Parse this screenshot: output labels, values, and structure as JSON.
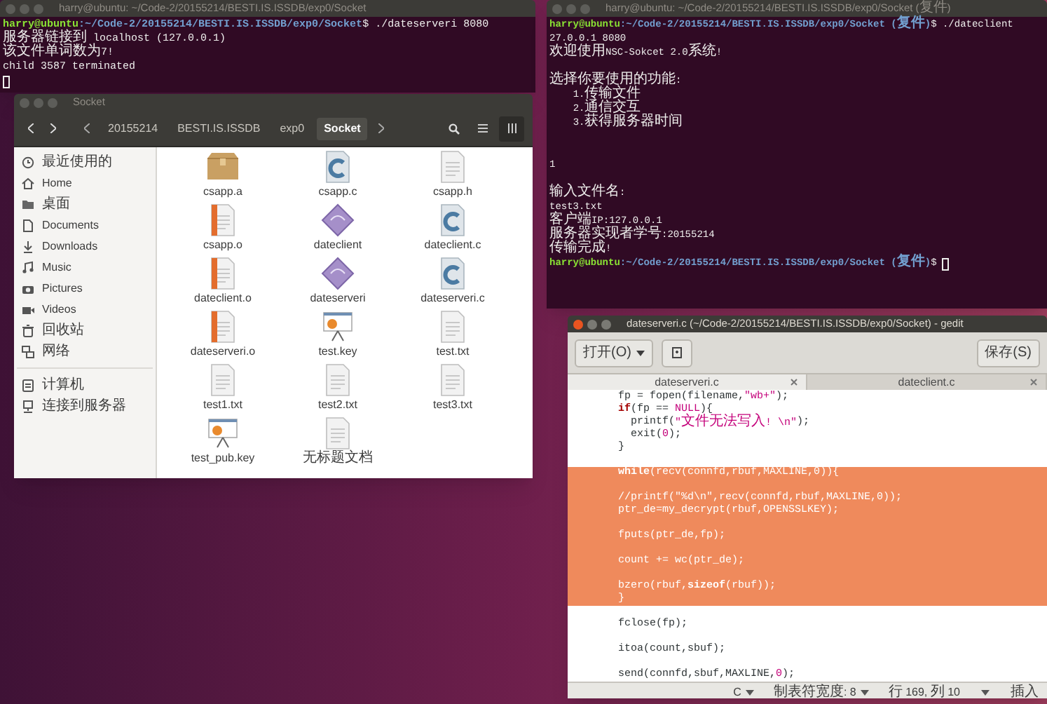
{
  "terminal_server": {
    "title": "harry@ubuntu: ~/Code-2/20155214/BESTI.IS.ISSDB/exp0/Socket",
    "focused": false,
    "lines": [
      {
        "kind": "prompt",
        "user": "harry@ubuntu",
        "path": ":~/Code-2/20155214/BESTI.IS.ISSDB/exp0/Socket",
        "command": "$ ./dateserveri 8080",
        "cursor": false
      },
      {
        "kind": "output",
        "text": "服务器链接到 localhost (127.0.0.1)"
      },
      {
        "kind": "output",
        "text": "该文件单词数为7!"
      },
      {
        "kind": "output",
        "text": "child 3587 terminated"
      },
      {
        "kind": "cursor"
      }
    ]
  },
  "file_manager": {
    "title": "Socket",
    "focused": false,
    "path": [
      {
        "label": "20155214",
        "selected": false
      },
      {
        "label": "BESTI.IS.ISSDB",
        "selected": false
      },
      {
        "label": "exp0",
        "selected": false
      },
      {
        "label": "Socket",
        "selected": true
      }
    ],
    "sidebar_groups": [
      {
        "items": [
          {
            "kind": "recent",
            "label": "最近使用的"
          },
          {
            "kind": "home",
            "label": "Home"
          },
          {
            "kind": "desktop",
            "label": "桌面"
          },
          {
            "kind": "documents",
            "label": "Documents"
          },
          {
            "kind": "downloads",
            "label": "Downloads"
          },
          {
            "kind": "music",
            "label": "Music"
          },
          {
            "kind": "pictures",
            "label": "Pictures"
          },
          {
            "kind": "videos",
            "label": "Videos"
          },
          {
            "kind": "trash",
            "label": "回收站"
          },
          {
            "kind": "network",
            "label": "网络"
          }
        ]
      },
      {
        "items": [
          {
            "kind": "computer",
            "label": "计算机"
          },
          {
            "kind": "server",
            "label": "连接到服务器"
          }
        ]
      }
    ],
    "files": [
      {
        "kind": "archive",
        "name": "csapp.a"
      },
      {
        "kind": "c-source",
        "name": "csapp.c"
      },
      {
        "kind": "header",
        "name": "csapp.h"
      },
      {
        "kind": "object",
        "name": "csapp.o"
      },
      {
        "kind": "executable",
        "name": "dateclient"
      },
      {
        "kind": "c-source",
        "name": "dateclient.c"
      },
      {
        "kind": "object",
        "name": "dateclient.o"
      },
      {
        "kind": "executable",
        "name": "dateserveri"
      },
      {
        "kind": "c-source",
        "name": "dateserveri.c"
      },
      {
        "kind": "object",
        "name": "dateserveri.o"
      },
      {
        "kind": "presentation",
        "name": "test.key"
      },
      {
        "kind": "text",
        "name": "test.txt"
      },
      {
        "kind": "text",
        "name": "test1.txt"
      },
      {
        "kind": "text",
        "name": "test2.txt"
      },
      {
        "kind": "text",
        "name": "test3.txt"
      },
      {
        "kind": "presentation",
        "name": "test_pub.key"
      },
      {
        "kind": "text",
        "name": "无标题文档"
      }
    ]
  },
  "terminal_client": {
    "title": "harry@ubuntu: ~/Code-2/20155214/BESTI.IS.ISSDB/exp0/Socket (复件)",
    "focused": false,
    "lines": [
      {
        "kind": "prompt",
        "user": "harry@ubuntu",
        "path": ":~/Code-2/20155214/BESTI.IS.ISSDB/exp0/Socket (复件)",
        "command": "$ ./dateclient",
        "cursor": false
      },
      {
        "kind": "output",
        "text": "27.0.0.1 8080"
      },
      {
        "kind": "output",
        "text": "欢迎使用NSC-Sokcet 2.0系统!"
      },
      {
        "kind": "blank"
      },
      {
        "kind": "output",
        "text": "选择你要使用的功能:"
      },
      {
        "kind": "output",
        "text": "\t1.传输文件"
      },
      {
        "kind": "output",
        "text": "\t2.通信交互"
      },
      {
        "kind": "output",
        "text": "\t3.获得服务器时间"
      },
      {
        "kind": "blank"
      },
      {
        "kind": "blank"
      },
      {
        "kind": "output",
        "text": "1"
      },
      {
        "kind": "blank"
      },
      {
        "kind": "output",
        "text": "输入文件名:"
      },
      {
        "kind": "output",
        "text": "test3.txt"
      },
      {
        "kind": "output",
        "text": "客户端IP:127.0.0.1"
      },
      {
        "kind": "output",
        "text": "服务器实现者学号:20155214"
      },
      {
        "kind": "output",
        "text": "传输完成!"
      },
      {
        "kind": "prompt",
        "user": "harry@ubuntu",
        "path": ":~/Code-2/20155214/BESTI.IS.ISSDB/exp0/Socket (复件)",
        "command": "$ ",
        "cursor": true
      }
    ]
  },
  "gedit": {
    "title": "dateserveri.c (~/Code-2/20155214/BESTI.IS.ISSDB/exp0/Socket) - gedit",
    "focused": true,
    "open_button": "打开(O)",
    "save_button": "保存(S)",
    "tabs": [
      {
        "label": "dateserveri.c",
        "selected": true
      },
      {
        "label": "dateclient.c",
        "selected": false
      }
    ],
    "code_lines": [
      {
        "kind": "code",
        "highlighted": false,
        "segments": [
          {
            "kind": "plain",
            "text": "fp = fopen(filename,"
          },
          {
            "kind": "string",
            "text": "\"wb+\""
          },
          {
            "kind": "plain",
            "text": ");"
          }
        ]
      },
      {
        "kind": "code",
        "highlighted": false,
        "segments": [
          {
            "kind": "keyword",
            "text": "if"
          },
          {
            "kind": "plain",
            "text": "(fp == "
          },
          {
            "kind": "constant",
            "text": "NULL"
          },
          {
            "kind": "plain",
            "text": "){"
          }
        ]
      },
      {
        "kind": "code",
        "highlighted": false,
        "segments": [
          {
            "kind": "plain",
            "text": "  printf("
          },
          {
            "kind": "string",
            "text": "\"文件无法写入! \\n\""
          },
          {
            "kind": "plain",
            "text": ");"
          }
        ]
      },
      {
        "kind": "code",
        "highlighted": false,
        "segments": [
          {
            "kind": "plain",
            "text": "  exit("
          },
          {
            "kind": "constant",
            "text": "0"
          },
          {
            "kind": "plain",
            "text": ");"
          }
        ]
      },
      {
        "kind": "code",
        "highlighted": false,
        "segments": [
          {
            "kind": "plain",
            "text": "}"
          }
        ]
      },
      {
        "kind": "blank",
        "highlighted": false
      },
      {
        "kind": "code",
        "highlighted": true,
        "segments": [
          {
            "kind": "keyword",
            "text": "while"
          },
          {
            "kind": "plain",
            "text": "(recv(connfd,rbuf,MAXLINE,"
          },
          {
            "kind": "constant",
            "text": "0"
          },
          {
            "kind": "plain",
            "text": ")){"
          }
        ]
      },
      {
        "kind": "blank",
        "highlighted": true
      },
      {
        "kind": "code",
        "highlighted": true,
        "segments": [
          {
            "kind": "comment",
            "text": "//printf(\"%d\\n\",recv(connfd,rbuf,MAXLINE,0));"
          }
        ]
      },
      {
        "kind": "code",
        "highlighted": true,
        "segments": [
          {
            "kind": "plain",
            "text": "ptr_de=my_decrypt(rbuf,OPENSSLKEY);"
          }
        ]
      },
      {
        "kind": "blank",
        "highlighted": true
      },
      {
        "kind": "code",
        "highlighted": true,
        "segments": [
          {
            "kind": "plain",
            "text": "fputs(ptr_de,fp);"
          }
        ]
      },
      {
        "kind": "blank",
        "highlighted": true
      },
      {
        "kind": "code",
        "highlighted": true,
        "segments": [
          {
            "kind": "plain",
            "text": "count += wc(ptr_de);"
          }
        ]
      },
      {
        "kind": "blank",
        "highlighted": true
      },
      {
        "kind": "code",
        "highlighted": true,
        "segments": [
          {
            "kind": "plain",
            "text": "bzero(rbuf,"
          },
          {
            "kind": "keyword",
            "text": "sizeof"
          },
          {
            "kind": "plain",
            "text": "(rbuf));"
          }
        ]
      },
      {
        "kind": "code",
        "highlighted": true,
        "segments": [
          {
            "kind": "plain",
            "text": "}"
          }
        ]
      },
      {
        "kind": "blank",
        "highlighted": false
      },
      {
        "kind": "code",
        "highlighted": false,
        "segments": [
          {
            "kind": "plain",
            "text": "fclose(fp);"
          }
        ]
      },
      {
        "kind": "blank",
        "highlighted": false
      },
      {
        "kind": "code",
        "highlighted": false,
        "segments": [
          {
            "kind": "plain",
            "text": "itoa(count,sbuf);"
          }
        ]
      },
      {
        "kind": "blank",
        "highlighted": false
      },
      {
        "kind": "code",
        "highlighted": false,
        "segments": [
          {
            "kind": "plain",
            "text": "send(connfd,sbuf,MAXLINE,"
          },
          {
            "kind": "constant",
            "text": "0"
          },
          {
            "kind": "plain",
            "text": ");"
          }
        ]
      }
    ],
    "status_bar": [
      {
        "kind": "dropdown",
        "text": "C"
      },
      {
        "kind": "dropdown",
        "text": "制表符宽度: 8"
      },
      {
        "kind": "label",
        "text": "行 169, 列 10"
      },
      {
        "kind": "caret"
      },
      {
        "kind": "label",
        "text": "插入"
      }
    ]
  }
}
